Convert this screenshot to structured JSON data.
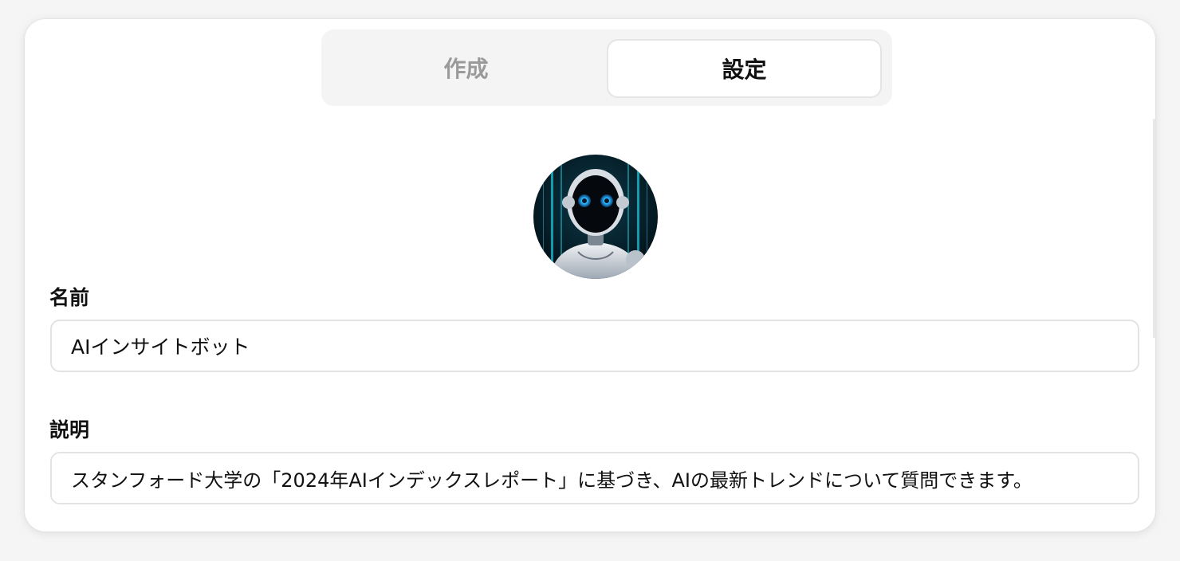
{
  "tabs": [
    {
      "label": "作成",
      "active": false
    },
    {
      "label": "設定",
      "active": true
    }
  ],
  "avatar": {
    "icon": "robot-avatar-icon"
  },
  "name_field": {
    "label": "名前",
    "value": "AIインサイトボット"
  },
  "description_field": {
    "label": "説明",
    "value": "スタンフォード大学の「2024年AIインデックスレポート」に基づき、AIの最新トレンドについて質問できます。"
  },
  "colors": {
    "active_tab_text": "#111111",
    "inactive_tab_text": "#9a9a9a",
    "tab_bar_bg": "#f4f4f4",
    "avatar_glow": "#29b6ff"
  }
}
